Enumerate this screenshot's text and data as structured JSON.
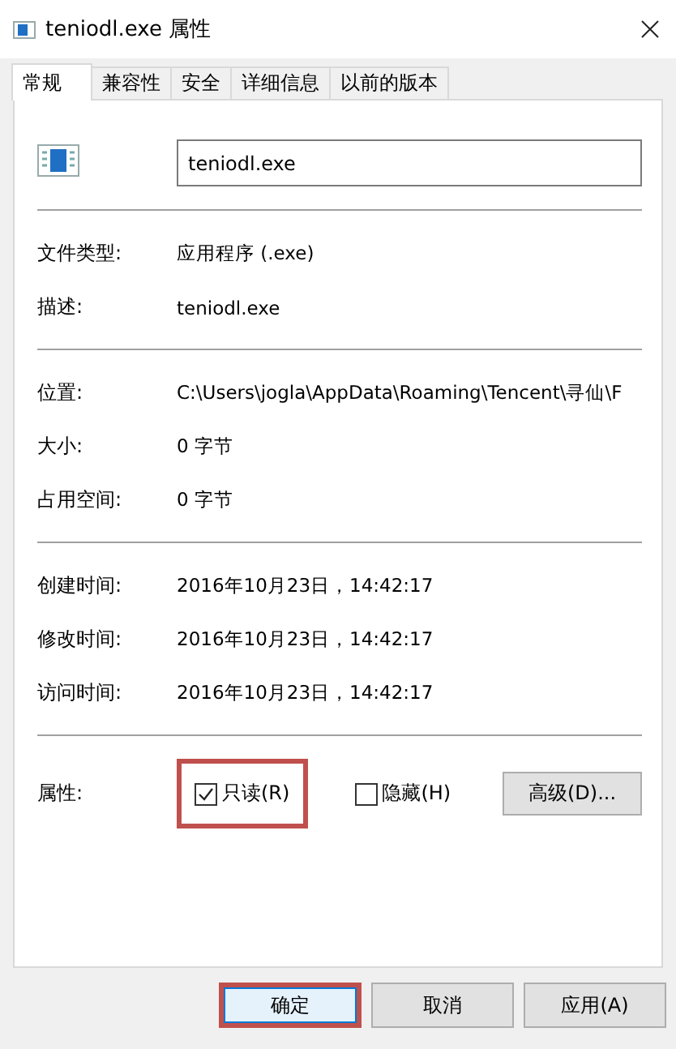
{
  "window": {
    "title": "teniodl.exe 属性"
  },
  "tabs": [
    {
      "label": "常规",
      "selected": true
    },
    {
      "label": "兼容性",
      "selected": false
    },
    {
      "label": "安全",
      "selected": false
    },
    {
      "label": "详细信息",
      "selected": false
    },
    {
      "label": "以前的版本",
      "selected": false
    }
  ],
  "file_name": {
    "value": "teniodl.exe"
  },
  "sections": [
    [
      {
        "label": "文件类型:",
        "value": "应用程序 (.exe)"
      },
      {
        "label": "描述:",
        "value": "teniodl.exe"
      }
    ],
    [
      {
        "label": "位置:",
        "value": "C:\\Users\\jogla\\AppData\\Roaming\\Tencent\\寻仙\\F"
      },
      {
        "label": "大小:",
        "value": "0 字节"
      },
      {
        "label": "占用空间:",
        "value": "0 字节"
      }
    ],
    [
      {
        "label": "创建时间:",
        "value": "2016年10月23日，14:42:17"
      },
      {
        "label": "修改时间:",
        "value": "2016年10月23日，14:42:17"
      },
      {
        "label": "访问时间:",
        "value": "2016年10月23日，14:42:17"
      }
    ]
  ],
  "attributes": {
    "label": "属性:",
    "checkboxes": [
      {
        "label": "只读(R)",
        "checked": true,
        "highlighted": true
      },
      {
        "label": "隐藏(H)",
        "checked": false,
        "highlighted": false
      }
    ],
    "advanced_button": "高级(D)..."
  },
  "buttons": [
    {
      "label": "确定",
      "default": true,
      "highlighted": true
    },
    {
      "label": "取消",
      "default": false,
      "highlighted": false
    },
    {
      "label": "应用(A)",
      "default": false,
      "highlighted": false
    }
  ]
}
